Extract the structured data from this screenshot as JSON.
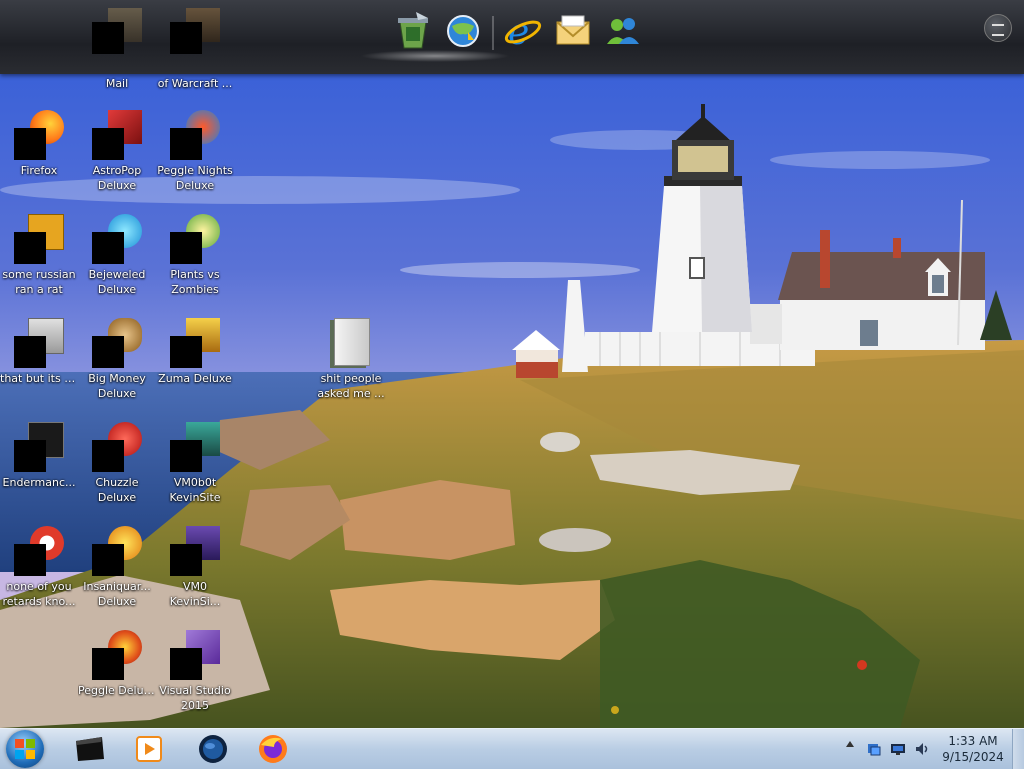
{
  "desktop": {
    "icons": [
      {
        "label_1": "Mail",
        "label_2": ""
      },
      {
        "label_1": "of Warcraft ...",
        "label_2": ""
      },
      {
        "label_1": "Firefox",
        "label_2": ""
      },
      {
        "label_1": "AstroPop",
        "label_2": "Deluxe"
      },
      {
        "label_1": "Peggle Nights",
        "label_2": "Deluxe"
      },
      {
        "label_1": "some russian",
        "label_2": "ran a rat"
      },
      {
        "label_1": "Bejeweled",
        "label_2": "Deluxe"
      },
      {
        "label_1": "Plants vs",
        "label_2": "Zombies"
      },
      {
        "label_1": "that but its c#",
        "label_2": ""
      },
      {
        "label_1": "Big Money",
        "label_2": "Deluxe"
      },
      {
        "label_1": "Zuma Deluxe",
        "label_2": ""
      },
      {
        "label_1": "shit people",
        "label_2": "asked me ..."
      },
      {
        "label_1": "Endermanc...",
        "label_2": ""
      },
      {
        "label_1": "Chuzzle",
        "label_2": "Deluxe"
      },
      {
        "label_1": "VM0b0t",
        "label_2": "KevinSite"
      },
      {
        "label_1": "none of you",
        "label_2": "retards kno..."
      },
      {
        "label_1": "Insaniquar...",
        "label_2": "Deluxe"
      },
      {
        "label_1": "VM0",
        "label_2": "KevinSi..."
      },
      {
        "label_1": "Peggle Deluxe",
        "label_2": ""
      },
      {
        "label_1": "Visual Studio",
        "label_2": "2015"
      }
    ]
  },
  "dock": {
    "icons": [
      "recycle-bin-icon",
      "update-globe-icon",
      "internet-explorer-icon",
      "mail-icon",
      "people-icon"
    ]
  },
  "taskbar": {
    "items": [
      "start-orb-icon",
      "black-app-icon",
      "media-player-icon",
      "globe-app-icon",
      "firefox-icon"
    ],
    "tray_icons": [
      "network-icon",
      "display-icon",
      "volume-icon"
    ],
    "time": "1:33 AM",
    "date": "9/15/2024"
  }
}
